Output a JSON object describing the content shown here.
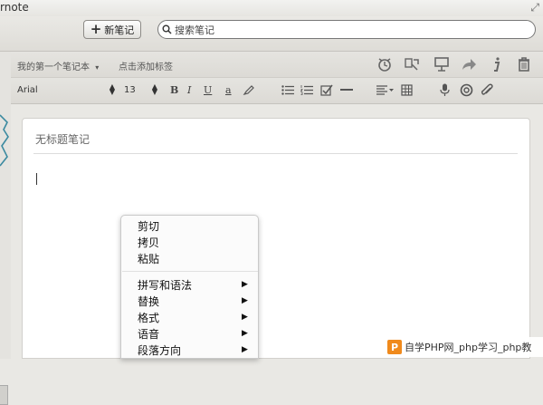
{
  "window": {
    "title": "rnote"
  },
  "toolbar": {
    "new_note_label": "新笔记",
    "search_placeholder": "搜索笔记"
  },
  "note_meta": {
    "notebook": "我的第一个笔记本",
    "add_tag": "点击添加标签"
  },
  "format_bar": {
    "font": "Arial",
    "size": "13",
    "bold": "B",
    "italic": "I",
    "underline": "U",
    "text_color": "a"
  },
  "note": {
    "title": "无标题笔记"
  },
  "context_menu": {
    "items": [
      "剪切",
      "拷贝",
      "粘贴"
    ],
    "submenus": [
      "拼写和语法",
      "替换",
      "格式",
      "语音",
      "段落方向"
    ]
  },
  "watermark": {
    "text": "自学PHP网_php学习_php教"
  }
}
